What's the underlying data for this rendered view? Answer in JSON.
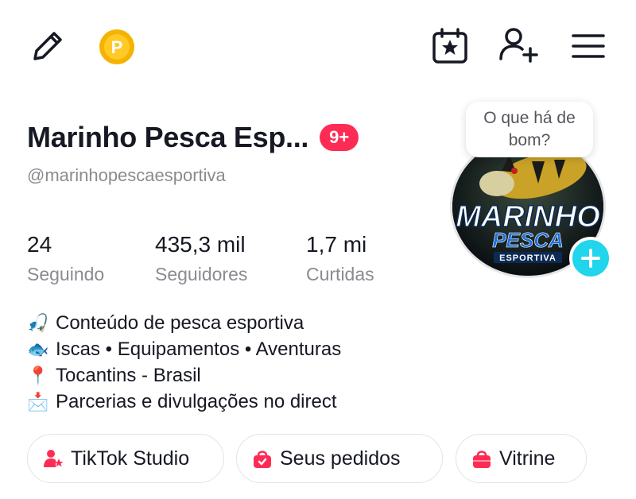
{
  "profile": {
    "display_name": "Marinho Pesca Esp...",
    "notification_badge": "9+",
    "username": "@marinhopescaesportiva",
    "avatar_text": {
      "line1": "MARINHO",
      "line2": "PESCA",
      "line3": "ESPORTIVA"
    },
    "status_bubble": "O que há de bom?"
  },
  "stats": [
    {
      "value": "24",
      "label": "Seguindo"
    },
    {
      "value": "435,3 mil",
      "label": "Seguidores"
    },
    {
      "value": "1,7 mi",
      "label": "Curtidas"
    }
  ],
  "bio": [
    {
      "emoji": "🎣",
      "text": "Conteúdo de pesca esportiva"
    },
    {
      "emoji": "🐟",
      "text": "Iscas • Equipamentos • Aventuras"
    },
    {
      "emoji": "📍",
      "text": "Tocantins - Brasil"
    },
    {
      "emoji": "📩",
      "text": "Parcerias e divulgações no direct"
    }
  ],
  "actions": [
    {
      "label": "TikTok Studio",
      "icon": "tiktok-studio-icon"
    },
    {
      "label": "Seus pedidos",
      "icon": "shopping-bag-icon"
    },
    {
      "label": "Vitrine",
      "icon": "shopping-bag-icon"
    }
  ],
  "topbar": {
    "icons": [
      "pencil-icon",
      "coin-icon",
      "calendar-star-icon",
      "add-user-icon",
      "menu-icon"
    ],
    "coin_letter": "P"
  },
  "colors": {
    "accent_red": "#fe2c55",
    "accent_cyan": "#20d5ec",
    "coin_gold": "#f5b301",
    "pink_icon": "#fe2c55",
    "text_primary": "#161823",
    "text_secondary": "#8a8b91"
  }
}
